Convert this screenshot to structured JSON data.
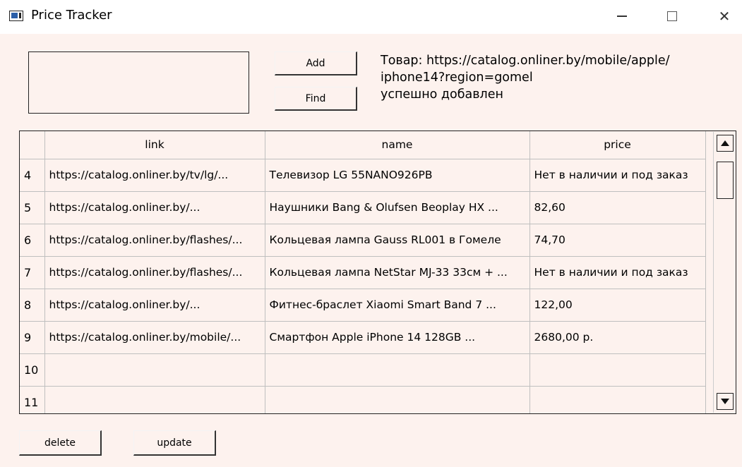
{
  "window": {
    "title": "Price Tracker",
    "controls": {
      "minimize": "—",
      "close": "✕"
    }
  },
  "toolbar": {
    "add_label": "Add",
    "find_label": "Find",
    "input_value": ""
  },
  "status": {
    "lines": [
      "Товар: https://catalog.onliner.by/mobile/apple/",
      "iphone14?region=gomel",
      "успешно добавлен"
    ]
  },
  "table": {
    "columns": [
      "link",
      "name",
      "price"
    ],
    "rows": [
      {
        "num": "4",
        "link": "https://catalog.onliner.by/tv/lg/...",
        "name": "Телевизор LG 55NANO926PB",
        "price": "Нет в наличии и под заказ"
      },
      {
        "num": "5",
        "link": "https://catalog.onliner.by/...",
        "name": "Наушники Bang & Olufsen Beoplay HX ...",
        "price": "82,60"
      },
      {
        "num": "6",
        "link": "https://catalog.onliner.by/flashes/...",
        "name": "Кольцевая лампа Gauss RL001 в Гомеле",
        "price": "74,70"
      },
      {
        "num": "7",
        "link": "https://catalog.onliner.by/flashes/...",
        "name": "Кольцевая лампа NetStar MJ-33 33см + ...",
        "price": "Нет в наличии и под заказ"
      },
      {
        "num": "8",
        "link": "https://catalog.onliner.by/...",
        "name": "Фитнес-браслет Xiaomi Smart Band 7 ...",
        "price": "122,00"
      },
      {
        "num": "9",
        "link": "https://catalog.onliner.by/mobile/...",
        "name": "Смартфон Apple iPhone 14 128GB ...",
        "price": "2680,00 р."
      },
      {
        "num": "10",
        "link": "",
        "name": "",
        "price": ""
      },
      {
        "num": "11",
        "link": "",
        "name": "",
        "price": ""
      }
    ]
  },
  "actions": {
    "delete_label": "delete",
    "update_label": "update"
  }
}
